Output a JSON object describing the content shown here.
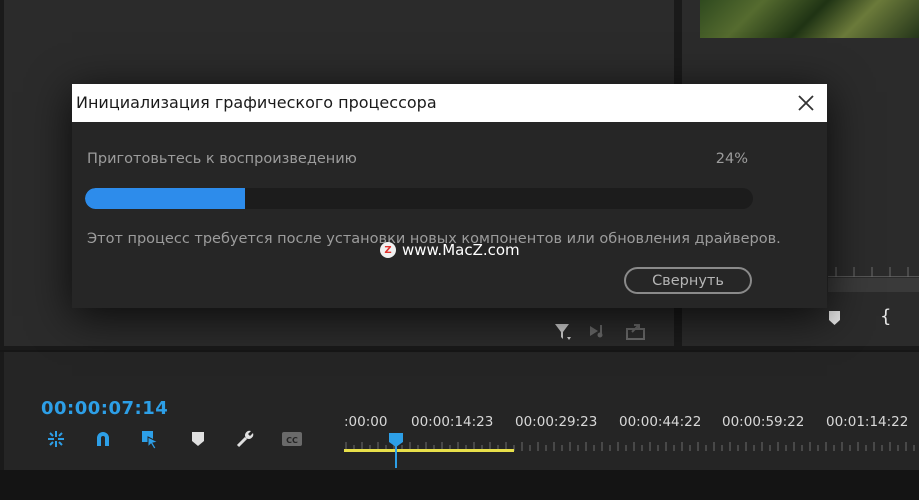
{
  "dialog": {
    "title": "Инициализация графического процессора",
    "status_text": "Приготовьтесь к воспроизведению",
    "percent_label": "24%",
    "progress": 0.24,
    "message": "Этот процесс требуется после установки новых компонентов или обновления драйверов.",
    "button_label": "Свернуть"
  },
  "timeline": {
    "timecode": "00:00:07:14",
    "ruler_labels": [
      ":00:00",
      "00:00:14:23",
      "00:00:29:23",
      "00:00:44:22",
      "00:00:59:22",
      "00:01:14:22"
    ]
  },
  "watermark": {
    "logo_letter": "Z",
    "text": "www.MacZ.com"
  },
  "colors": {
    "accent": "#2d9fe7",
    "progress_fill": "#2d8ceb",
    "work_area": "#e8e04a",
    "dialog_bg": "#262626",
    "panel_bg": "#2b2b2b"
  },
  "icons": {
    "timeline_tools": [
      "insert-snap-icon",
      "magnet-icon",
      "linked-selection-icon",
      "add-marker-icon",
      "wrench-icon",
      "captions-icon"
    ],
    "source_controls": [
      "filter-icon",
      "audio-icon",
      "export-frame-icon"
    ],
    "close": "close-icon"
  }
}
